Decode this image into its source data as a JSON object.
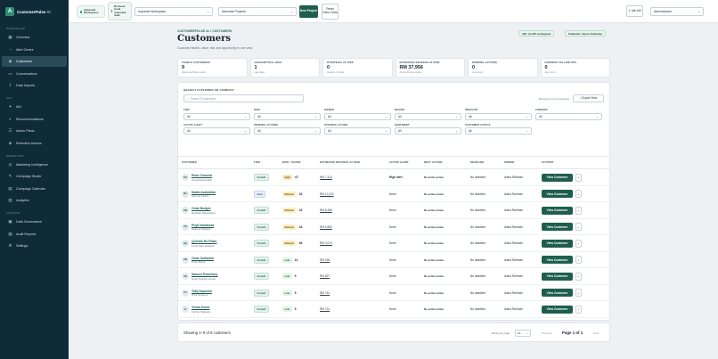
{
  "brand": {
    "logo_letter": "A",
    "name": "CustomerPulse",
    "ai": "AI"
  },
  "nav": {
    "sections": [
      {
        "label": "Workspace",
        "items": [
          {
            "label": "Overview",
            "icon": "grid-icon",
            "glyph": "▦"
          },
          {
            "label": "Alert Centre",
            "icon": "bell-icon",
            "glyph": "◔"
          },
          {
            "label": "Customers",
            "icon": "users-icon",
            "glyph": "◉",
            "active": true
          },
          {
            "label": "Conversations",
            "icon": "chat-icon",
            "glyph": "▭"
          },
          {
            "label": "Data Imports",
            "icon": "upload-icon",
            "glyph": "⇪"
          }
        ]
      },
      {
        "label": "AKA",
        "items": [
          {
            "label": "AKI",
            "icon": "spark-icon",
            "glyph": "✦"
          },
          {
            "label": "Recommendations",
            "icon": "bulb-icon",
            "glyph": "◐"
          },
          {
            "label": "Action Plans",
            "icon": "checklist-icon",
            "glyph": "☰"
          },
          {
            "label": "Retention Actions",
            "icon": "shield-icon",
            "glyph": "◈"
          }
        ]
      },
      {
        "label": "Marketing",
        "items": [
          {
            "label": "Marketing Intelligence",
            "icon": "target-icon",
            "glyph": "◎"
          },
          {
            "label": "Campaign Studio",
            "icon": "megaphone-icon",
            "glyph": "✎"
          },
          {
            "label": "Campaign Calendar",
            "icon": "calendar-icon",
            "glyph": "▤"
          },
          {
            "label": "Analytics",
            "icon": "chart-icon",
            "glyph": "▥"
          }
        ]
      },
      {
        "label": "Control",
        "items": [
          {
            "label": "Data Governance",
            "icon": "database-icon",
            "glyph": "▣"
          },
          {
            "label": "Audit Reports",
            "icon": "report-icon",
            "glyph": "▧"
          },
          {
            "label": "Settings",
            "icon": "gear-icon",
            "glyph": "⚙"
          }
        ]
      }
    ]
  },
  "topbar": {
    "chip1": "Imported Workspace",
    "chip2": "Browser-local imported data",
    "workspace_select": "Imported Workspace",
    "project_select": "Alternate Projects",
    "new_project": "New Project",
    "reset_demo": "Reset Demo Data",
    "ask_aki": "Ask AKI",
    "role_select": "Administrator"
  },
  "page": {
    "breadcrumb": "CUSTOMERPULSE AI / CUSTOMERS",
    "title": "Customers",
    "subtitle": "Customer health, value, risk and opportunity in one view.",
    "pill_aki": "AKI: AI-API configured",
    "pill_publisher": "Publisher: Demo Publisher"
  },
  "kpis": [
    {
      "label": "VISIBLE CUSTOMERS",
      "value": "9",
      "note": "Filtered portfolio records"
    },
    {
      "label": "HIGH/CRITICAL RISK",
      "value": "1",
      "note": "open flags"
    },
    {
      "label": "STRATEGIC AT RISK",
      "value": "0",
      "note": "Medium or higher"
    },
    {
      "label": "ESTIMATED REVENUE AT RISK",
      "value": "RM 37,956",
      "note": "Across 60-day window"
    },
    {
      "label": "PENDING ACTIONS",
      "value": "0",
      "note": "open items"
    },
    {
      "label": "OVERDUE FOLLOW-UPS",
      "value": "0",
      "note": "open items"
    }
  ],
  "filters": {
    "title": "SEARCH CUSTOMER OR COMPANY",
    "search_placeholder": "Search 9 customers",
    "showing": "Showing 9 of 9 customers",
    "export": "Export View",
    "rows": [
      [
        {
          "label": "TIER",
          "value": "All"
        },
        {
          "label": "RISK",
          "value": "All"
        },
        {
          "label": "OWNER",
          "value": "All"
        },
        {
          "label": "REGION",
          "value": "All"
        },
        {
          "label": "INDUSTRY",
          "value": "All"
        },
        {
          "label": "CONSENT",
          "value": "All"
        }
      ],
      [
        {
          "label": "ACTIVE ALERT",
          "value": "All"
        },
        {
          "label": "PENDING ACTIONS",
          "value": "All"
        },
        {
          "label": "OVERDUE ACTION",
          "value": "All"
        },
        {
          "label": "SENTIMENT",
          "value": "All"
        },
        {
          "label": "CUSTOMER STATUS",
          "value": "All"
        }
      ]
    ]
  },
  "table": {
    "headers": [
      "CUSTOMER",
      "TIER",
      "RISK / SCORE",
      "ESTIMATED REVENUE AT RISK",
      "ACTIVE ALERT",
      "NEXT ACTION",
      "DEADLINE",
      "OWNER",
      "ACTIONS"
    ],
    "view_label": "View Customer",
    "more_label": "⌄",
    "rows": [
      {
        "initials": "RO",
        "name": "Ross Osmond",
        "company": "Greenfield Health",
        "tier": "Growth",
        "tier_class": "growth",
        "risk": "High",
        "risk_class": "high",
        "score": "67",
        "revenue": "RM 7,414",
        "alert": "High alert",
        "alert_bold": true,
        "next": "No active action",
        "deadline": "No deadline",
        "owner": "Aisha Rahman"
      },
      {
        "initials": "MA",
        "name": "Nadia Azaluddan",
        "company": "Summa Clinics",
        "tier": "Core",
        "tier_class": "core",
        "risk": "Medium",
        "risk_class": "medium",
        "score": "33",
        "revenue": "RM 12,222",
        "alert": "None",
        "alert_bold": false,
        "next": "No active action",
        "deadline": "No deadline",
        "owner": "Aisha Rahman"
      },
      {
        "initials": "OW",
        "name": "Omar Budget",
        "company": "Meridian Diagnostics",
        "tier": "Growth",
        "tier_class": "growth",
        "risk": "Medium",
        "risk_class": "medium",
        "score": "43",
        "revenue": "RM 6,456",
        "alert": "None",
        "alert_bold": false,
        "next": "No active action",
        "deadline": "No deadline",
        "owner": "Aisha Rahman"
      },
      {
        "initials": "PN",
        "name": "Priya Nowstead",
        "company": "Harbour Medical",
        "tier": "Growth",
        "tier_class": "growth",
        "risk": "Medium",
        "risk_class": "medium",
        "score": "44",
        "revenue": "RM 6,583",
        "alert": "None",
        "alert_bold": false,
        "next": "No active action",
        "deadline": "No deadline",
        "owner": "Aisha Rahman"
      },
      {
        "initials": "QH",
        "name": "Quentin Ho Pham",
        "company": "Lotus Care Network",
        "tier": "Growth",
        "tier_class": "growth",
        "risk": "Medium",
        "risk_class": "medium",
        "score": "46",
        "revenue": "RM 4,074",
        "alert": "None",
        "alert_bold": false,
        "next": "No active action",
        "deadline": "No deadline",
        "owner": "Aisha Rahman"
      },
      {
        "initials": "OW",
        "name": "Omar Sultaman",
        "company": "Pixel Works",
        "tier": "Growth",
        "tier_class": "growth",
        "risk": "Low",
        "risk_class": "low",
        "score": "14",
        "revenue": "RM 926",
        "alert": "None",
        "alert_bold": false,
        "next": "No active action",
        "deadline": "No deadline",
        "owner": "Aisha Rahman"
      },
      {
        "initials": "SR",
        "name": "Samuel Rosemary",
        "company": "Nova Therapy Group",
        "tier": "Growth",
        "tier_class": "growth",
        "risk": "Low",
        "risk_class": "low",
        "score": "9",
        "revenue": "RM 827",
        "alert": "None",
        "alert_bold": false,
        "next": "No active action",
        "deadline": "No deadline",
        "owner": "Aisha Rahman"
      },
      {
        "initials": "CA",
        "name": "Tally Saponim",
        "company": "Orbit Systems",
        "tier": "Growth",
        "tier_class": "growth",
        "risk": "Low",
        "risk_class": "low",
        "score": "9",
        "revenue": "RM 742",
        "alert": "None",
        "alert_bold": false,
        "next": "No active action",
        "deadline": "No deadline",
        "owner": "Aisha Rahman"
      },
      {
        "initials": "VI",
        "name": "Vivian Donlo",
        "company": "Anchor Software",
        "tier": "Growth",
        "tier_class": "growth",
        "risk": "Low",
        "risk_class": "low",
        "score": "5",
        "revenue": "RM 731",
        "alert": "None",
        "alert_bold": false,
        "next": "No active action",
        "deadline": "No deadline",
        "owner": "Aisha Rahman"
      }
    ]
  },
  "pager": {
    "showing": "Showing 1–9 of 9 customers",
    "rows_per_page": "Rows per page",
    "per_page_value": "10",
    "previous": "Previous",
    "page": "Page 1 of 1",
    "next": "Next"
  }
}
